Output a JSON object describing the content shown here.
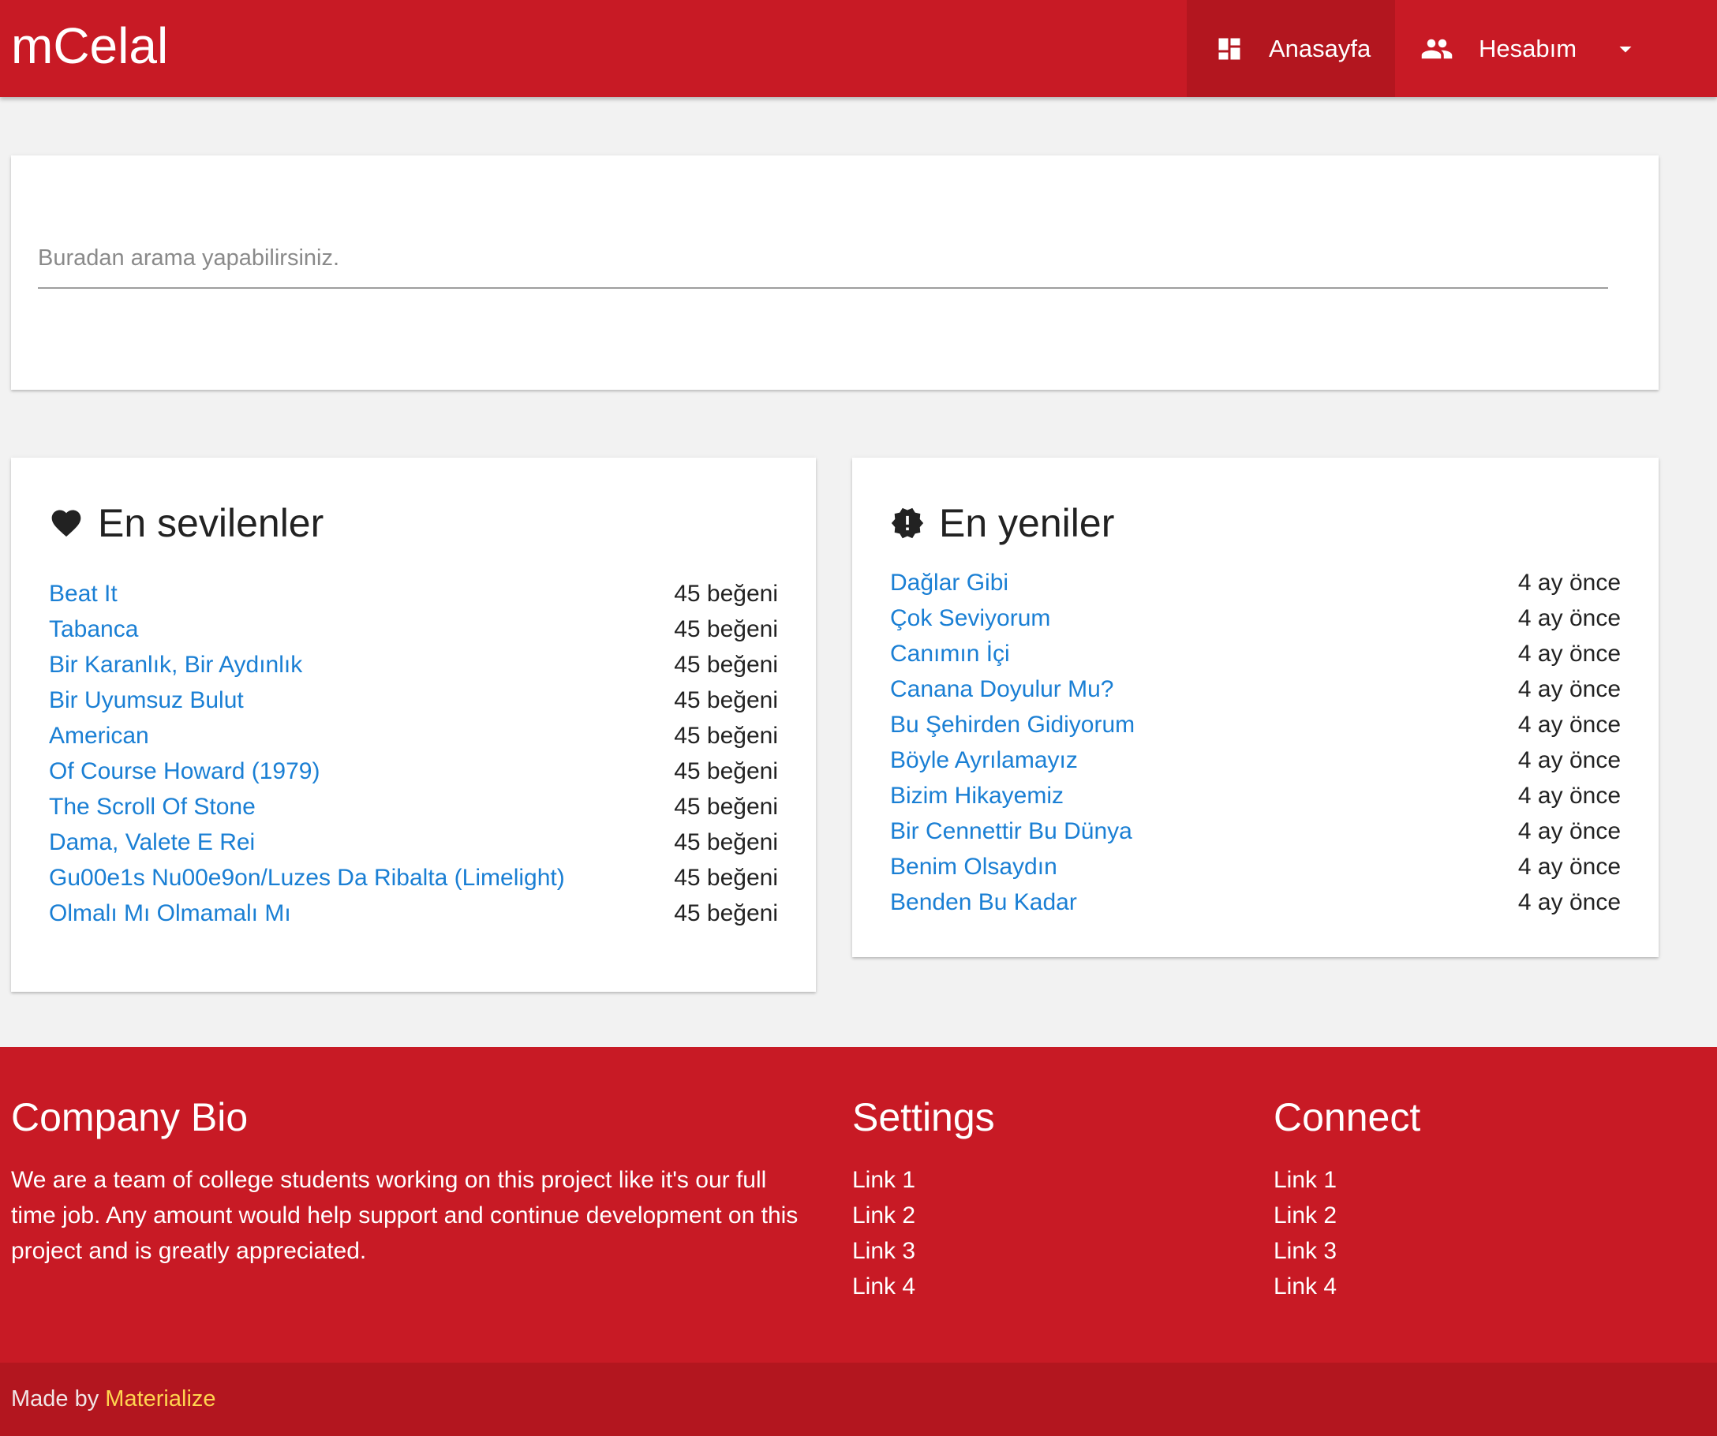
{
  "header": {
    "brand": "mCelal",
    "nav": [
      {
        "label": "Anasayfa",
        "icon": "dashboard-icon"
      },
      {
        "label": "Hesabım",
        "icon": "people-icon"
      }
    ]
  },
  "search": {
    "placeholder": "Buradan arama yapabilirsiniz.",
    "value": ""
  },
  "most_liked": {
    "title": "En sevilenler",
    "icon": "heart-icon",
    "items": [
      {
        "name": "Beat It",
        "meta": "45 beğeni"
      },
      {
        "name": "Tabanca",
        "meta": "45 beğeni"
      },
      {
        "name": "Bir Karanlık, Bir Aydınlık",
        "meta": "45 beğeni"
      },
      {
        "name": "Bir Uyumsuz Bulut",
        "meta": "45 beğeni"
      },
      {
        "name": "American",
        "meta": "45 beğeni"
      },
      {
        "name": "Of Course Howard (1979)",
        "meta": "45 beğeni"
      },
      {
        "name": "The Scroll Of Stone",
        "meta": "45 beğeni"
      },
      {
        "name": "Dama, Valete E Rei",
        "meta": "45 beğeni"
      },
      {
        "name": "Gu00e1s Nu00e9on/Luzes Da Ribalta (Limelight)",
        "meta": "45 beğeni"
      },
      {
        "name": "Olmalı Mı Olmamalı Mı",
        "meta": "45 beğeni"
      }
    ]
  },
  "newest": {
    "title": "En yeniler",
    "icon": "new-releases-icon",
    "items": [
      {
        "name": "Dağlar Gibi",
        "meta": "4 ay önce"
      },
      {
        "name": "Çok Seviyorum",
        "meta": "4 ay önce"
      },
      {
        "name": "Canımın İçi",
        "meta": "4 ay önce"
      },
      {
        "name": "Canana Doyulur Mu?",
        "meta": "4 ay önce"
      },
      {
        "name": "Bu Şehirden Gidiyorum",
        "meta": "4 ay önce"
      },
      {
        "name": "Böyle Ayrılamayız",
        "meta": "4 ay önce"
      },
      {
        "name": "Bizim Hikayemiz",
        "meta": "4 ay önce"
      },
      {
        "name": "Bir Cennettir Bu Dünya",
        "meta": "4 ay önce"
      },
      {
        "name": "Benim Olsaydın",
        "meta": "4 ay önce"
      },
      {
        "name": "Benden Bu Kadar",
        "meta": "4 ay önce"
      }
    ]
  },
  "footer": {
    "bio_title": "Company Bio",
    "bio_text": "We are a team of college students working on this project like it's our full time job. Any amount would help support and continue development on this project and is greatly appreciated.",
    "settings_title": "Settings",
    "settings_links": [
      "Link 1",
      "Link 2",
      "Link 3",
      "Link 4"
    ],
    "connect_title": "Connect",
    "connect_links": [
      "Link 1",
      "Link 2",
      "Link 3",
      "Link 4"
    ],
    "made_by_prefix": "Made by ",
    "made_by_link": "Materialize"
  },
  "colors": {
    "primary": "#c81a25",
    "primary_dark": "#b3161f",
    "link": "#1a7fd4",
    "accent": "#ffd54f"
  }
}
